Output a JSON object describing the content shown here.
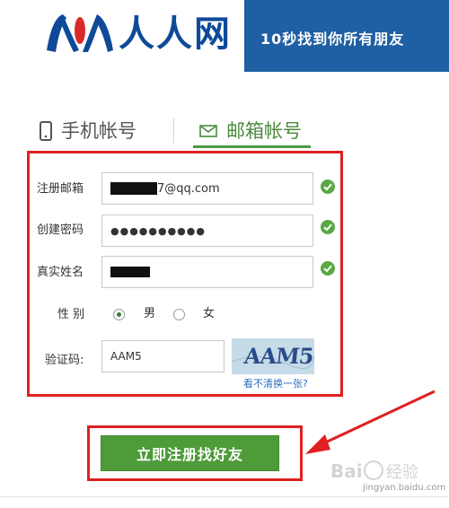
{
  "header": {
    "logo_text": "人人网",
    "slogan": "10秒找到你所有朋友"
  },
  "tabs": [
    {
      "label": "手机帐号",
      "icon": "mobile-phone-icon",
      "active": false
    },
    {
      "label": "邮箱帐号",
      "icon": "envelope-icon",
      "active": true
    }
  ],
  "form": {
    "email": {
      "label": "注册邮箱",
      "value_suffix": "7@qq.com",
      "valid": true
    },
    "password": {
      "label": "创建密码",
      "value": "●●●●●●●●●●",
      "valid": true
    },
    "realname": {
      "label": "真实姓名",
      "valid": true
    },
    "gender": {
      "label": "性 别",
      "options": [
        "男",
        "女"
      ],
      "selected": "男"
    },
    "captcha": {
      "label": "验证码:",
      "value": "AAM5",
      "image_text": "AAM5",
      "refresh_link": "看不清换一张?"
    }
  },
  "submit_label": "立即注册找好友",
  "watermark": {
    "text": "jingyan.baidu.com"
  },
  "colors": {
    "header_blue": "#1f5fa3",
    "logo_blue": "#0e4a97",
    "active_green": "#4a9a42",
    "button_green": "#4e9b3a",
    "annotation_red": "#e02020"
  }
}
